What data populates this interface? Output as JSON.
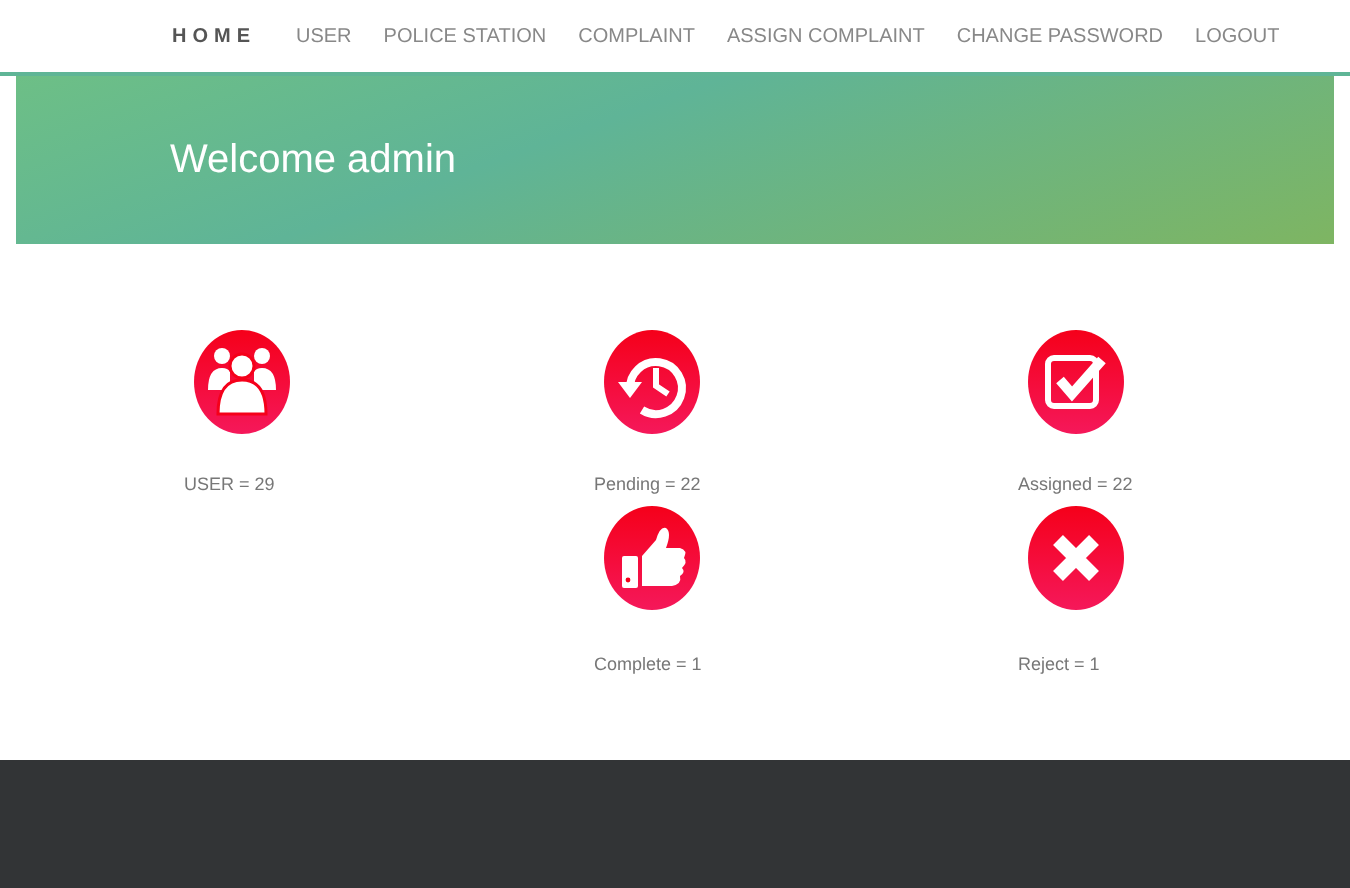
{
  "nav": [
    {
      "label": "HOME",
      "selected": true
    },
    {
      "label": "USER",
      "selected": false
    },
    {
      "label": "POLICE STATION",
      "selected": false
    },
    {
      "label": "COMPLAINT",
      "selected": false
    },
    {
      "label": "ASSIGN COMPLAINT",
      "selected": false
    },
    {
      "label": "CHANGE PASSWORD",
      "selected": false
    },
    {
      "label": "LOGOUT",
      "selected": false
    }
  ],
  "banner": {
    "title": "Welcome admin"
  },
  "stats": [
    {
      "kind": "users",
      "label": "USER = 29"
    },
    {
      "kind": "pending",
      "label": "Pending = 22"
    },
    {
      "kind": "assigned",
      "label": "Assigned = 22"
    },
    {
      "kind": "complete",
      "label": "Complete = 1"
    },
    {
      "kind": "reject",
      "label": "Reject = 1"
    }
  ]
}
